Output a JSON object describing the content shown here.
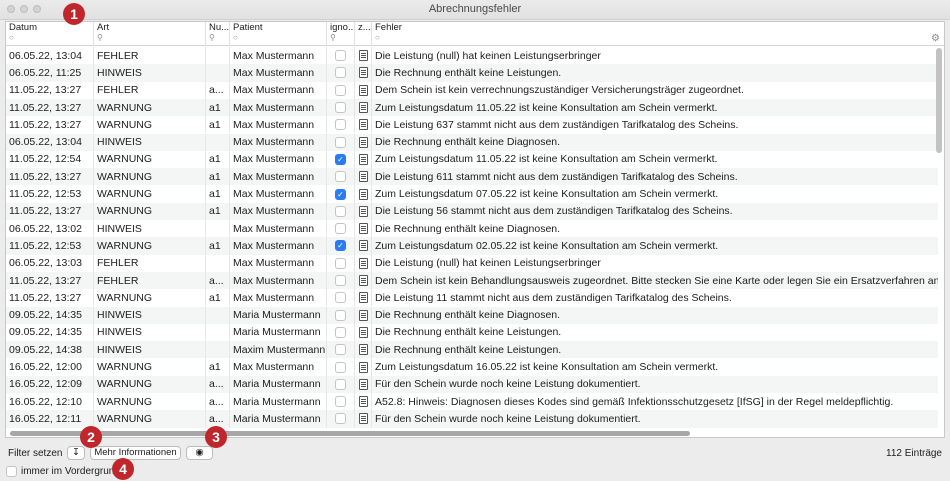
{
  "window": {
    "title": "Abrechnungsfehler"
  },
  "columns": [
    {
      "label": "Datum",
      "icon": "circle-icon"
    },
    {
      "label": "Art",
      "icon": "search-icon"
    },
    {
      "label": "Nu...",
      "icon": "search-icon"
    },
    {
      "label": "Patient",
      "icon": "circle-icon"
    },
    {
      "label": "igno...",
      "icon": "search-icon"
    },
    {
      "label": "z...",
      "icon": ""
    },
    {
      "label": "Fehler",
      "icon": "circle-icon"
    }
  ],
  "rows": [
    {
      "date": "06.05.22, 13:04",
      "art": "FEHLER",
      "nu": "",
      "patient": "Max Mustermann",
      "ignored": false,
      "msg": "Die Leistung (null) hat keinen Leistungserbringer"
    },
    {
      "date": "06.05.22, 11:25",
      "art": "HINWEIS",
      "nu": "",
      "patient": "Max Mustermann",
      "ignored": false,
      "msg": "Die Rechnung enthält keine Leistungen."
    },
    {
      "date": "11.05.22, 13:27",
      "art": "FEHLER",
      "nu": "a...",
      "patient": "Max Mustermann",
      "ignored": false,
      "msg": "Dem Schein ist kein verrechnungszuständiger Versicherungsträger zugeordnet."
    },
    {
      "date": "11.05.22, 13:27",
      "art": "WARNUNG",
      "nu": "a1",
      "patient": "Max Mustermann",
      "ignored": false,
      "msg": "Zum Leistungsdatum 11.05.22 ist keine Konsultation am Schein vermerkt."
    },
    {
      "date": "11.05.22, 13:27",
      "art": "WARNUNG",
      "nu": "a1",
      "patient": "Max Mustermann",
      "ignored": false,
      "msg": "Die Leistung 637 stammt nicht aus dem zuständigen Tarifkatalog des Scheins."
    },
    {
      "date": "06.05.22, 13:04",
      "art": "HINWEIS",
      "nu": "",
      "patient": "Max Mustermann",
      "ignored": false,
      "msg": "Die Rechnung enthält keine Diagnosen."
    },
    {
      "date": "11.05.22, 12:54",
      "art": "WARNUNG",
      "nu": "a1",
      "patient": "Max Mustermann",
      "ignored": true,
      "msg": "Zum Leistungsdatum 11.05.22 ist keine Konsultation am Schein vermerkt."
    },
    {
      "date": "11.05.22, 13:27",
      "art": "WARNUNG",
      "nu": "a1",
      "patient": "Max Mustermann",
      "ignored": false,
      "msg": "Die Leistung 611 stammt nicht aus dem zuständigen Tarifkatalog des Scheins."
    },
    {
      "date": "11.05.22, 12:53",
      "art": "WARNUNG",
      "nu": "a1",
      "patient": "Max Mustermann",
      "ignored": true,
      "msg": "Zum Leistungsdatum 07.05.22 ist keine Konsultation am Schein vermerkt."
    },
    {
      "date": "11.05.22, 13:27",
      "art": "WARNUNG",
      "nu": "a1",
      "patient": "Max Mustermann",
      "ignored": false,
      "msg": "Die Leistung 56 stammt nicht aus dem zuständigen Tarifkatalog des Scheins."
    },
    {
      "date": "06.05.22, 13:02",
      "art": "HINWEIS",
      "nu": "",
      "patient": "Max Mustermann",
      "ignored": false,
      "msg": "Die Rechnung enthält keine Diagnosen."
    },
    {
      "date": "11.05.22, 12:53",
      "art": "WARNUNG",
      "nu": "a1",
      "patient": "Max Mustermann",
      "ignored": true,
      "msg": "Zum Leistungsdatum 02.05.22 ist keine Konsultation am Schein vermerkt."
    },
    {
      "date": "06.05.22, 13:03",
      "art": "FEHLER",
      "nu": "",
      "patient": "Max Mustermann",
      "ignored": false,
      "msg": "Die Leistung (null) hat keinen Leistungserbringer"
    },
    {
      "date": "11.05.22, 13:27",
      "art": "FEHLER",
      "nu": "a...",
      "patient": "Max Mustermann",
      "ignored": false,
      "msg": "Dem Schein ist kein Behandlungsausweis zugeordnet. Bitte stecken Sie eine Karte oder legen Sie ein Ersatzverfahren an."
    },
    {
      "date": "11.05.22, 13:27",
      "art": "WARNUNG",
      "nu": "a1",
      "patient": "Max Mustermann",
      "ignored": false,
      "msg": "Die Leistung 11 stammt nicht aus dem zuständigen Tarifkatalog des Scheins."
    },
    {
      "date": "09.05.22, 14:35",
      "art": "HINWEIS",
      "nu": "",
      "patient": "Maria Mustermann",
      "ignored": false,
      "msg": "Die Rechnung enthält keine Diagnosen."
    },
    {
      "date": "09.05.22, 14:35",
      "art": "HINWEIS",
      "nu": "",
      "patient": "Maria Mustermann",
      "ignored": false,
      "msg": "Die Rechnung enthält keine Leistungen."
    },
    {
      "date": "09.05.22, 14:38",
      "art": "HINWEIS",
      "nu": "",
      "patient": "Maxim Mustermann",
      "ignored": false,
      "msg": "Die Rechnung enthält keine Leistungen."
    },
    {
      "date": "16.05.22, 12:00",
      "art": "WARNUNG",
      "nu": "a1",
      "patient": "Max Mustermann",
      "ignored": false,
      "msg": "Zum Leistungsdatum 16.05.22 ist keine Konsultation am Schein vermerkt."
    },
    {
      "date": "16.05.22, 12:09",
      "art": "WARNUNG",
      "nu": "a...",
      "patient": "Maria Mustermann",
      "ignored": false,
      "msg": "Für den Schein wurde noch keine Leistung dokumentiert."
    },
    {
      "date": "16.05.22, 12:10",
      "art": "WARNUNG",
      "nu": "a...",
      "patient": "Maria Mustermann",
      "ignored": false,
      "msg": "A52.8: Hinweis: Diagnosen dieses Kodes sind gemäß Infektionsschutzgesetz [IfSG] in der Regel meldepflichtig."
    },
    {
      "date": "16.05.22, 12:11",
      "art": "WARNUNG",
      "nu": "a...",
      "patient": "Maria Mustermann",
      "ignored": false,
      "msg": "Für den Schein wurde noch keine Leistung dokumentiert."
    }
  ],
  "footer": {
    "filter_label": "Filter setzen",
    "filter_icon": "filter-arrow-icon",
    "more_info_label": "Mehr Informationen",
    "reset_icon": "circle-dot-icon",
    "count": "112 Einträge",
    "always_on_top_label": "immer im Vordergrund"
  },
  "callouts": [
    "1",
    "2",
    "3",
    "4"
  ],
  "colors": {
    "callout": "#c0272d",
    "checkbox_on": "#2a7cf6"
  }
}
